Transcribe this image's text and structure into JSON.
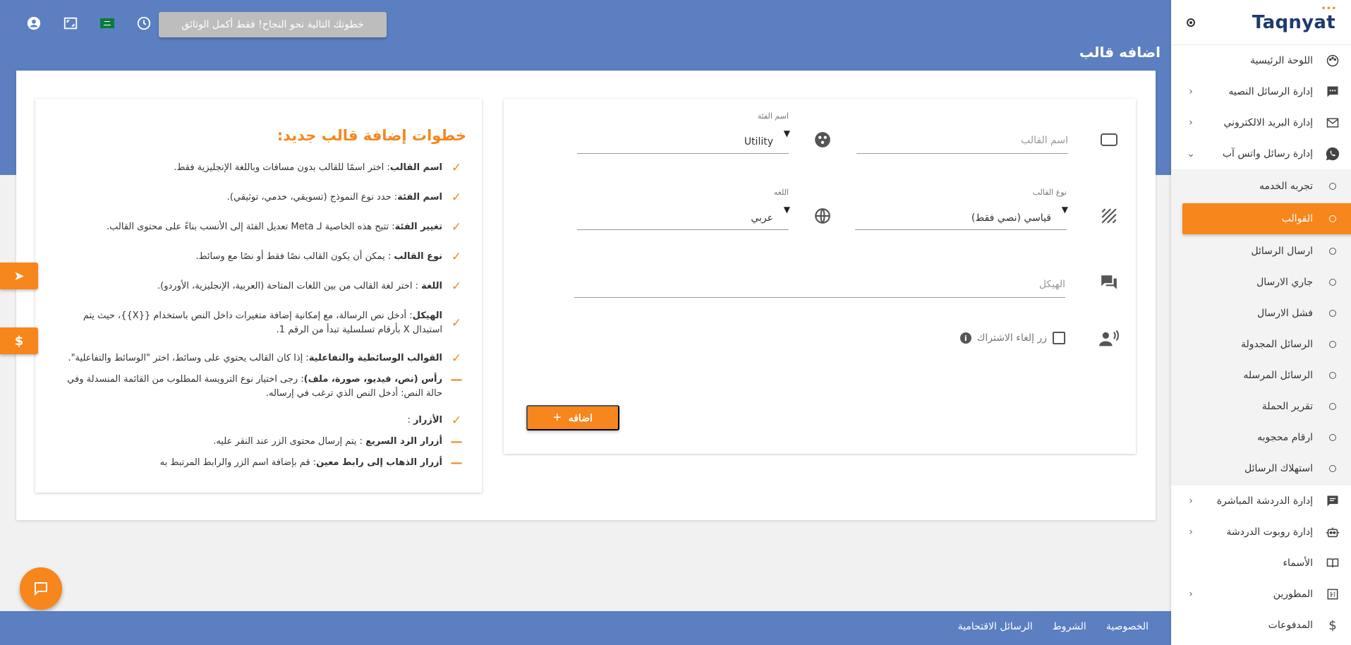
{
  "sidebar": {
    "logo": "Taqnyat",
    "logo_dots": "•••",
    "items": [
      {
        "label": "اللوحة الرئيسية"
      },
      {
        "label": "إدارة الرسائل النصيه",
        "chevron": "‹"
      },
      {
        "label": "إدارة البريد الالكتروني",
        "chevron": "‹"
      },
      {
        "label": "إدارة رسائل واتس آب",
        "chevron": "⌄"
      }
    ],
    "whatsapp_sub": [
      {
        "label": "تجربه الخدمه"
      },
      {
        "label": "القوالب"
      },
      {
        "label": "ارسال الرسائل"
      },
      {
        "label": "جاري الارسال"
      },
      {
        "label": "فشل الارسال"
      },
      {
        "label": "الرسائل المجدولة"
      },
      {
        "label": "الرسائل المرسله"
      },
      {
        "label": "تقرير الحملة"
      },
      {
        "label": "ارقام محجوبه"
      },
      {
        "label": "استهلاك الرسائل"
      }
    ],
    "items_after": [
      {
        "label": "إدارة الدردشة المباشرة",
        "chevron": "‹"
      },
      {
        "label": "إدارة روبوت الدردشة",
        "chevron": "‹"
      },
      {
        "label": "الأسماء"
      },
      {
        "label": "المطورين",
        "chevron": "‹"
      },
      {
        "label": "المدفوعات"
      }
    ]
  },
  "header": {
    "notice": "خطوتك التالية نحو النجاح! فقط أكمل الوثائق",
    "page_title": "اضافه قالب",
    "colors": {
      "primary": "#5b7fc0",
      "accent": "#f7861c"
    }
  },
  "form": {
    "template_name_placeholder": "اسم القالب",
    "category_label": "اسم الفئة",
    "category_value": "Utility",
    "template_type_label": "نوع القالب",
    "template_type_value": "قياسي (نصي فقط)",
    "language_label": "اللغه",
    "language_value": "عربي",
    "body_placeholder": "الهيكل",
    "unsubscribe_label": "زر إلغاء الاشتراك",
    "add_button": "اضافه",
    "add_icon": "+"
  },
  "steps": {
    "title": "خطوات إضافة قالب جديد:",
    "items": [
      {
        "mark": "✓",
        "bold": "اسم القالب",
        "text": ": اختر اسمًا للقالب بدون مسافات وباللغة الإنجليزية فقط."
      },
      {
        "mark": "✓",
        "bold": "اسم الفئة",
        "text": ": حدد نوع النموذج (تسويقي، خدمي، توثيقي)."
      },
      {
        "mark": "✓",
        "bold": "تغيير الفئة",
        "text": ": تتيح هذه الخاصية لـ Meta تعديل الفئة إلى الأنسب بناءً على محتوى القالب."
      },
      {
        "mark": "✓",
        "bold": "نوع القالب",
        "text": " : يمكن أن يكون القالب نصًا فقط أو نصًا مع وسائط."
      },
      {
        "mark": "✓",
        "bold": "اللغة",
        "text": " : اختر لغة القالب من بين اللغات المتاحة (العربية، الإنجليزية، الأوردو)."
      },
      {
        "mark": "✓",
        "bold": "الهيكل",
        "text": ": أدخل نص الرسالة، مع إمكانية إضافة متغيرات داخل النص باستخدام {{X}}، حيث يتم استبدال X بأرقام تسلسلية تبدأ من الرقم 1."
      },
      {
        "mark": "✓",
        "bold": "القوالب الوسائطية والتفاعلية",
        "text": ": إذا كان القالب يحتوي على وسائط، اختر \"الوسائط والتفاعلية\"."
      },
      {
        "mark": "—",
        "bold": "رأس (نص، فيديو، صورة، ملف)",
        "text": ": رجى اختيار نوع الترويسة المطلوب من القائمة المنسدلة وفي حالة النص: أدخل النص الذي ترغب في إرساله."
      },
      {
        "mark": "✓",
        "bold": "الأزرار",
        "text": " :"
      },
      {
        "mark": "—",
        "bold": "أزرار الرد السريع",
        "text": " : يتم إرسال محتوى الزر عند النقر عليه."
      },
      {
        "mark": "—",
        "bold": "أزرار الذهاب إلى رابط معين",
        "text": ": قم بإضافة اسم الزر والرابط المرتبط به"
      }
    ]
  },
  "floats": {
    "send_icon": "➤",
    "pay_icon": "$"
  },
  "footer": {
    "links": [
      "الخصوصية",
      "الشروط",
      "الرسائل الاقتحامية"
    ]
  }
}
